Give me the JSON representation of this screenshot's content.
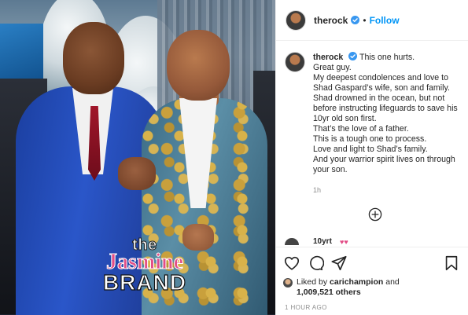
{
  "post": {
    "username": "therock",
    "follow_label": "Follow",
    "separator": "•",
    "caption_lead": "This one hurts.",
    "caption_lines": [
      "Great guy.",
      "My deepest condolences and love to",
      "Shad Gaspard’s wife, son and family.",
      "Shad drowned in the ocean, but not",
      "before instructing lifeguards to save his",
      "10yr old son first.",
      "That’s the love of a father.",
      "This is a tough one to process.",
      "Love and light to Shad’s family.",
      "And your warrior spirit lives on through",
      "your son."
    ],
    "caption_time": "1h",
    "partial_comment": "10yrt",
    "liked_by_prefix": "Liked by",
    "liked_by_user": "carichampion",
    "liked_by_and": "and",
    "likes_count": "1,009,521 others",
    "timestamp": "1 HOUR AGO"
  },
  "watermark": {
    "line1": "the",
    "line2": "Jasmine",
    "line3": "BRAND"
  },
  "colors": {
    "accent": "#0095f6",
    "watermark_pink": "#e24d86",
    "text": "#262626",
    "muted": "#8e8e8e"
  },
  "icons": [
    "verified-badge-icon",
    "heart-icon",
    "comment-icon",
    "share-icon",
    "bookmark-icon",
    "add-comment-icon"
  ]
}
